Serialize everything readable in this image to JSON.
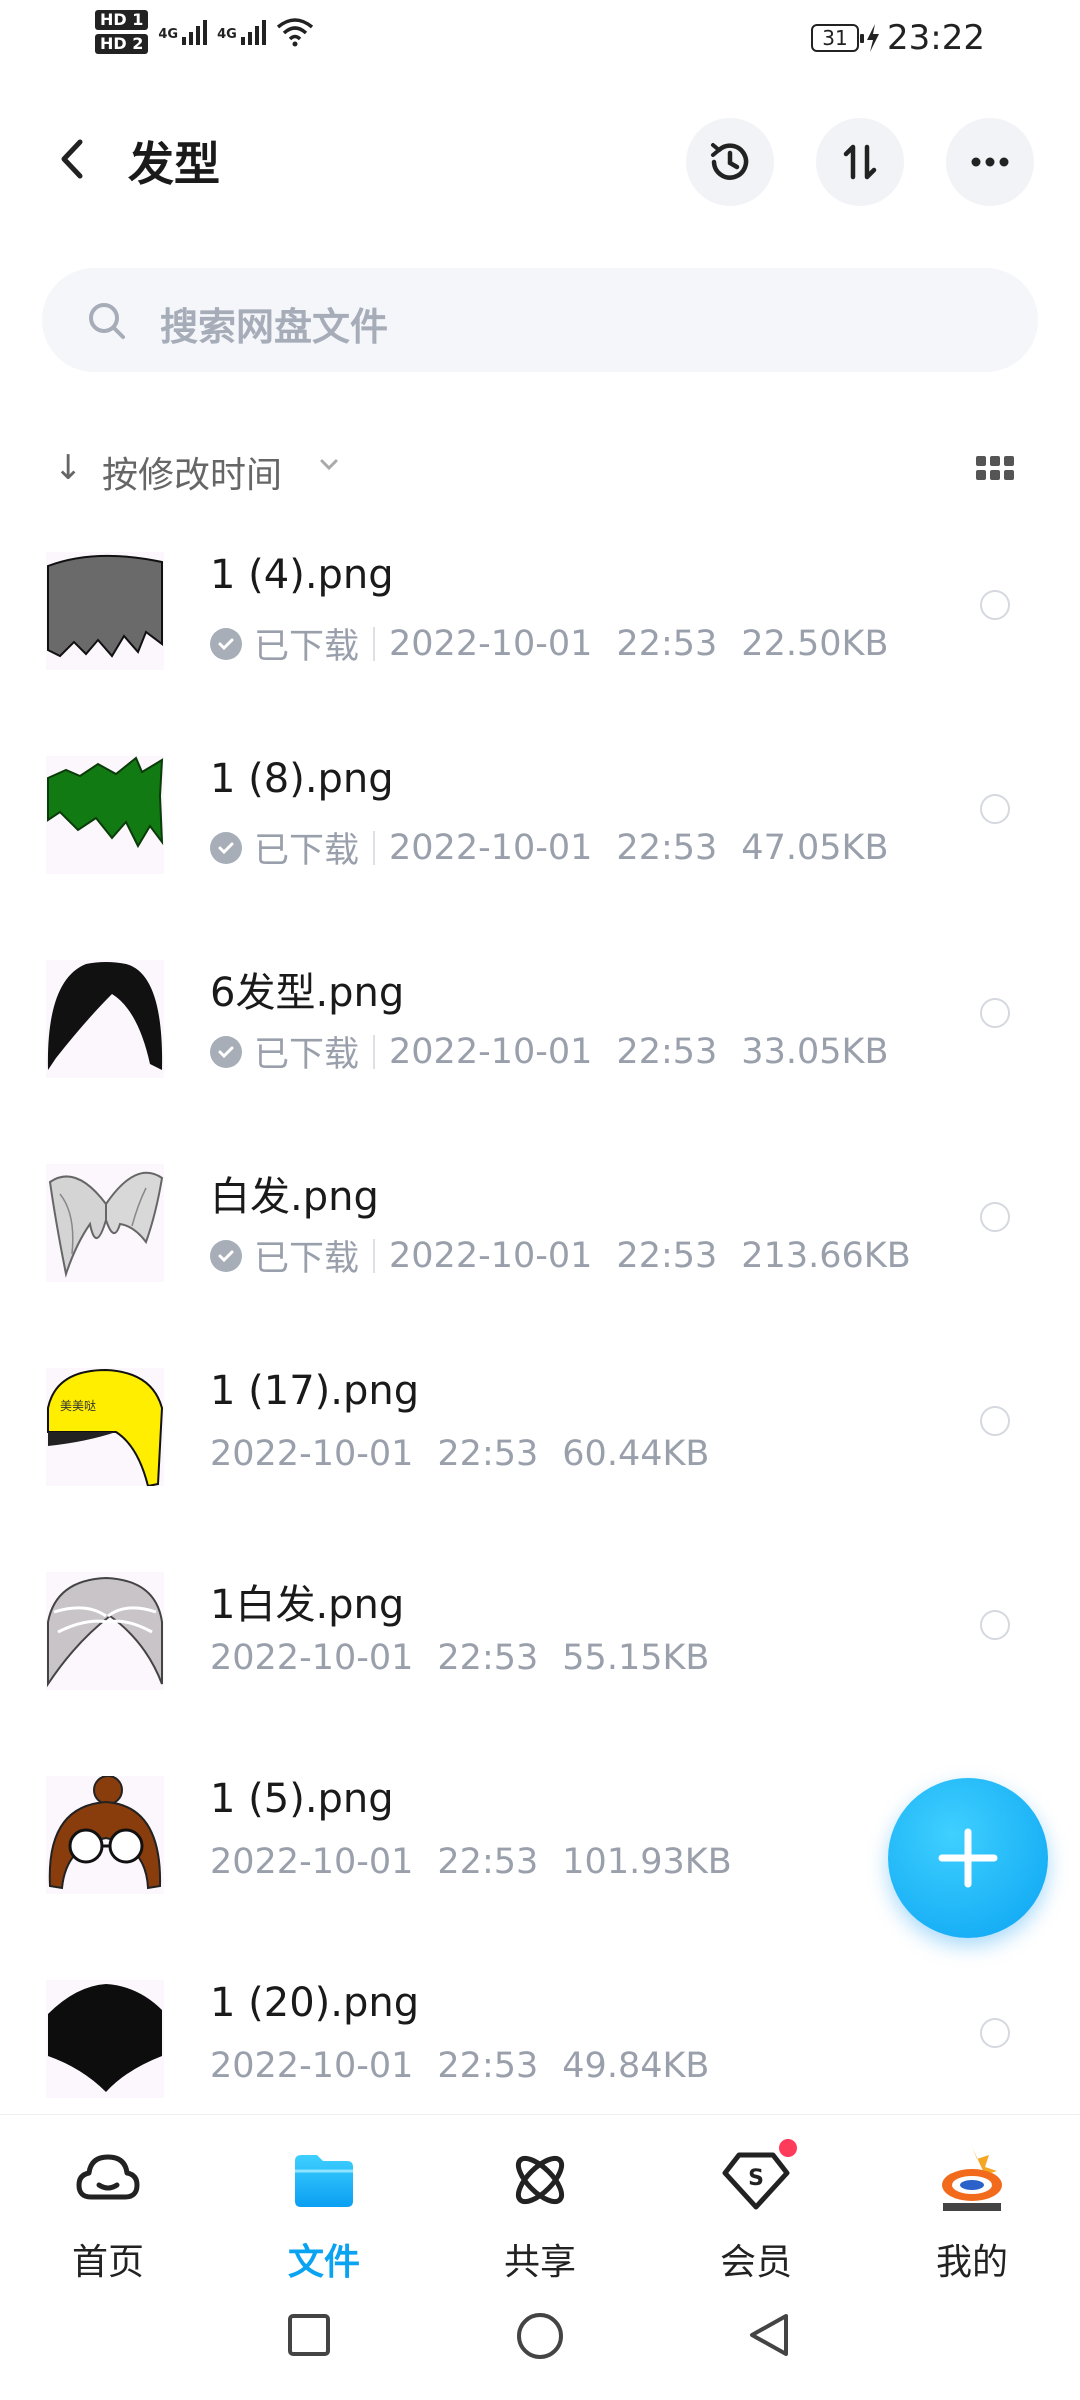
{
  "status_bar": {
    "hd1": "HD 1",
    "hd2": "HD 2",
    "net1": "4G",
    "net2": "4G",
    "battery": "31",
    "time": "23:22"
  },
  "header": {
    "title": "发型"
  },
  "search": {
    "placeholder": "搜索网盘文件"
  },
  "sort": {
    "arrow": "↓",
    "label": "按修改时间"
  },
  "files": [
    {
      "name": "1 (4).png",
      "downloaded": "已下载",
      "date": "2022-10-01",
      "time": "22:53",
      "size": "22.50KB"
    },
    {
      "name": "1 (8).png",
      "downloaded": "已下载",
      "date": "2022-10-01",
      "time": "22:53",
      "size": "47.05KB"
    },
    {
      "name": "6发型.png",
      "downloaded": "已下载",
      "date": "2022-10-01",
      "time": "22:53",
      "size": "33.05KB"
    },
    {
      "name": "白发.png",
      "downloaded": "已下载",
      "date": "2022-10-01",
      "time": "22:53",
      "size": "213.66KB"
    },
    {
      "name": "1 (17).png",
      "date": "2022-10-01",
      "time": "22:53",
      "size": "60.44KB"
    },
    {
      "name": "1白发.png",
      "date": "2022-10-01",
      "time": "22:53",
      "size": "55.15KB"
    },
    {
      "name": "1 (5).png",
      "date": "2022-10-01",
      "time": "22:53",
      "size": "101.93KB"
    },
    {
      "name": "1 (20).png",
      "date": "2022-10-01",
      "time": "22:53",
      "size": "49.84KB"
    }
  ],
  "tabs": [
    {
      "label": "首页",
      "icon": "cloud-icon"
    },
    {
      "label": "文件",
      "icon": "folder-icon"
    },
    {
      "label": "共享",
      "icon": "atom-icon"
    },
    {
      "label": "会员",
      "icon": "vip-icon"
    },
    {
      "label": "我的",
      "icon": "avatar-icon"
    }
  ],
  "colors": {
    "accent": "#0aa3f2",
    "badge": "#ff3b5c"
  }
}
